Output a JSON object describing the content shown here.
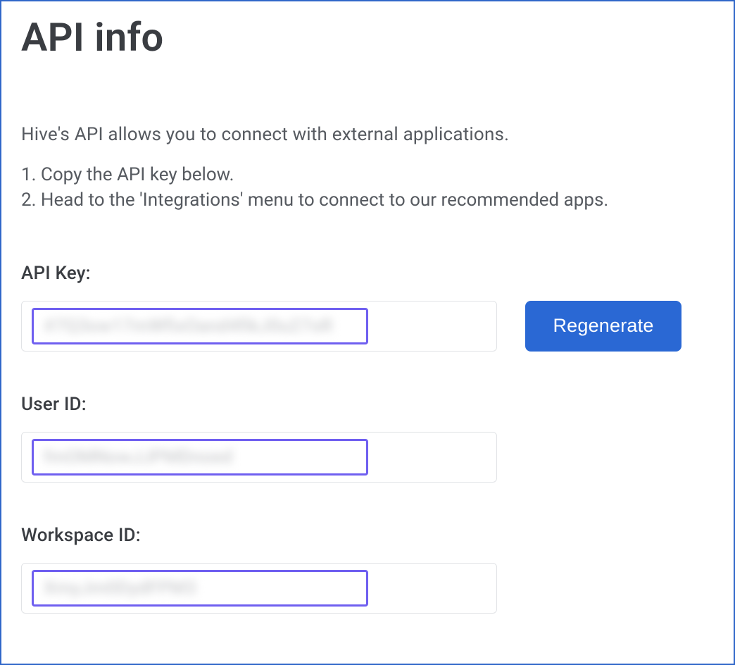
{
  "title": "API info",
  "intro": "Hive's API allows you to connect with external applications.",
  "steps": {
    "step1": "1. Copy the API key below.",
    "step2": "2. Head to the 'Integrations' menu to connect to our recommended apps."
  },
  "fields": {
    "apiKey": {
      "label": "API Key:",
      "value": "#7Q3ow17mWfixOand4fikJ0u27oR",
      "regenerateLabel": "Regenerate"
    },
    "userId": {
      "label": "User ID:",
      "value": "fmOMNowJJPMDnoed"
    },
    "workspaceId": {
      "label": "Workspace ID:",
      "value": "XmyJm0DydFPM3"
    }
  },
  "colors": {
    "panelBorder": "#3067c9",
    "innerBorder": "#6f5ff0",
    "buttonBg": "#2a68d4"
  }
}
